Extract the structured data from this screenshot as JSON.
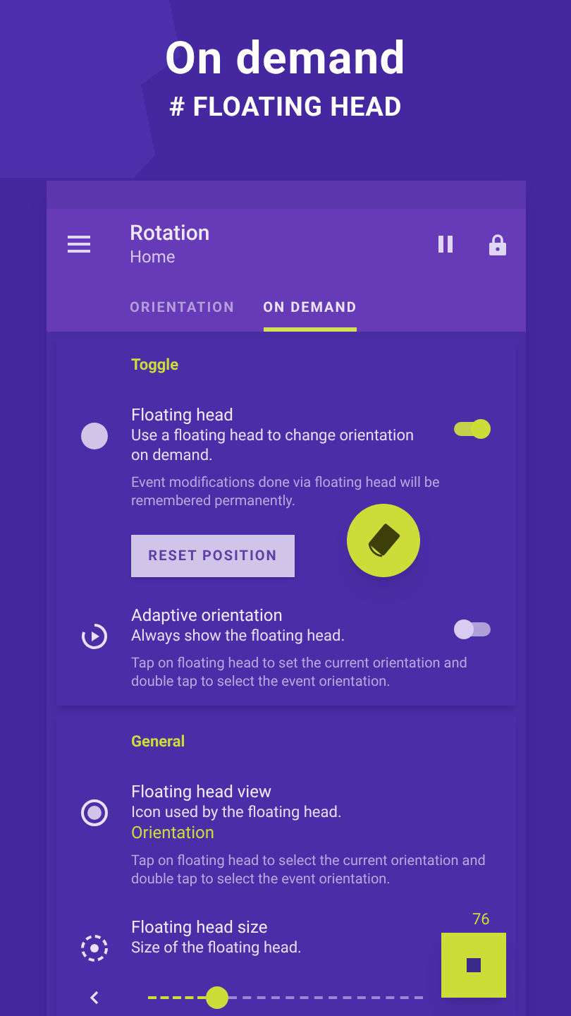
{
  "headline": "On demand",
  "subheadline": "# FLOATING HEAD",
  "app_bar": {
    "title": "Rotation",
    "subtitle": "Home"
  },
  "tabs": [
    {
      "label": "ORIENTATION",
      "selected": false
    },
    {
      "label": "ON DEMAND",
      "selected": true
    }
  ],
  "sections": [
    {
      "header": "Toggle",
      "items": [
        {
          "kind": "switch",
          "title": "Floating head",
          "summary": "Use a floating head to change orientation on demand.",
          "on": true,
          "note": "Event modifications done via floating head will be remembered permanently.",
          "button": "RESET POSITION"
        },
        {
          "kind": "switch",
          "title": "Adaptive orientation",
          "summary": "Always show the floating head.",
          "on": false,
          "note": "Tap on floating head to set the current orientation and double tap to select the event orientation."
        }
      ]
    },
    {
      "header": "General",
      "items": [
        {
          "kind": "value",
          "title": "Floating head view",
          "summary": "Icon used by the floating head.",
          "value": "Orientation",
          "note": "Tap on floating head to select the current orientation and double tap to select the event orientation."
        },
        {
          "kind": "slider",
          "title": "Floating head size",
          "summary": "Size of the floating head.",
          "level": 0.25,
          "reading": "76"
        }
      ]
    }
  ]
}
